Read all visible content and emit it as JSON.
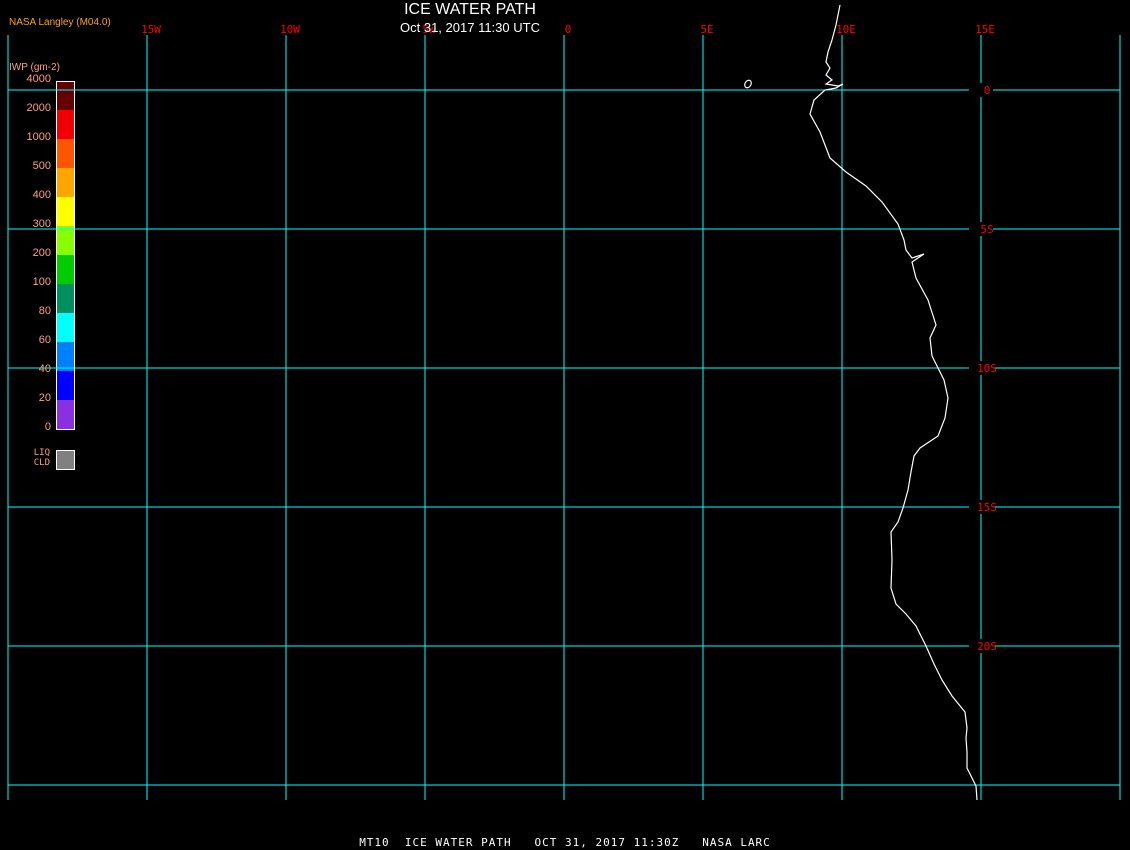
{
  "header": {
    "title": "ICE WATER PATH",
    "subtitle": "Oct 31, 2017 11:30 UTC",
    "source": "NASA Langley (M04.0)"
  },
  "legend": {
    "units": "IWP (gm-2)",
    "labels": [
      "4000",
      "2000",
      "1000",
      "500",
      "400",
      "300",
      "200",
      "100",
      "80",
      "60",
      "40",
      "20",
      "0"
    ],
    "colors": [
      "#660000",
      "#f00000",
      "#ff5500",
      "#ffa500",
      "#ffff00",
      "#88ff00",
      "#00cc00",
      "#008f5f",
      "#00ffff",
      "#0080ff",
      "#0000ff",
      "#8a30e0"
    ],
    "liquid_cloud_label": "LIQ CLD",
    "liquid_cloud_color": "#808080"
  },
  "map": {
    "grid_color": "#00ffff",
    "label_color": "#ff0000",
    "coastline_color": "#ffffff",
    "lon_labels": [
      "15W",
      "10W",
      "5W",
      "0",
      "5E",
      "10E",
      "15E"
    ],
    "lat_labels": [
      "0",
      "5S",
      "10S",
      "15S",
      "20S"
    ]
  },
  "caption": "MT10  ICE WATER PATH   OCT 31, 2017 11:30Z   NASA LARC"
}
